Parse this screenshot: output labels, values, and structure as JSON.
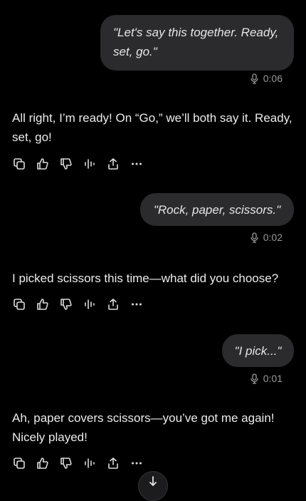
{
  "messages": [
    {
      "role": "user",
      "text": "\"Let's say this together. Ready, set, go.\"",
      "duration": "0:06"
    },
    {
      "role": "assistant",
      "text": "All right, I’m ready! On “Go,” we’ll both say it. Ready, set, go!"
    },
    {
      "role": "user",
      "text": "\"Rock, paper, scissors.\"",
      "duration": "0:02"
    },
    {
      "role": "assistant",
      "text": "I picked scissors this time—what did you choose?"
    },
    {
      "role": "user",
      "text": "\"I pick...\"",
      "duration": "0:01"
    },
    {
      "role": "assistant",
      "text": "Ah, paper covers scissors—you’ve got me again! Nicely played!"
    }
  ],
  "icons": {
    "duration": "microphone-icon",
    "actions": [
      "copy-icon",
      "thumbs-up-icon",
      "thumbs-down-icon",
      "voice-playback-icon",
      "share-icon",
      "more-icon"
    ],
    "scroll": "arrow-down-icon"
  },
  "colors": {
    "background": "#000000",
    "bubble": "#2b2b2d",
    "text": "#ececec",
    "muted": "#9a9a9a"
  }
}
